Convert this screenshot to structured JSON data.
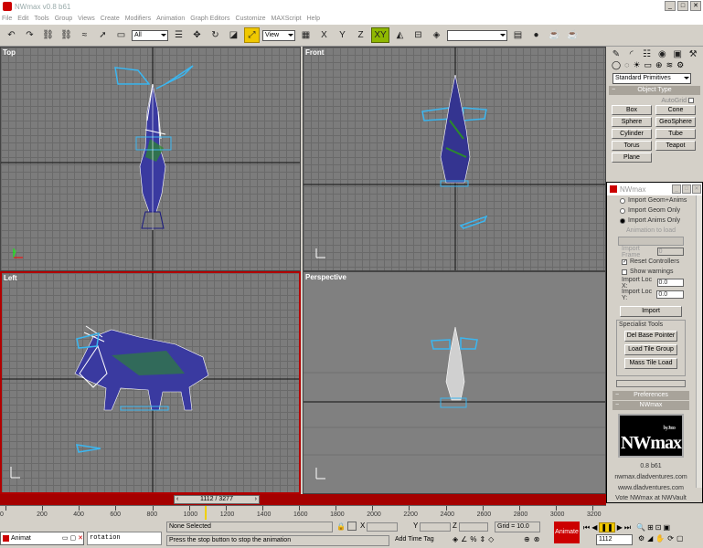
{
  "window": {
    "title": "NWmax v0.8 b61",
    "buttons": [
      "_",
      "□",
      "✕"
    ]
  },
  "menu": [
    "File",
    "Edit",
    "Tools",
    "Group",
    "Views",
    "Create",
    "Modifiers",
    "Animation",
    "Graph Editors",
    "Customize",
    "MAXScript",
    "Help"
  ],
  "toolbar": {
    "selection_filter": "All",
    "ref_coord": "View",
    "axis": "XY",
    "named_selection": ""
  },
  "viewports": {
    "top": "Top",
    "front": "Front",
    "left": "Left",
    "perspective": "Perspective"
  },
  "command_panel": {
    "category": "Standard Primitives",
    "object_type_header": "Object Type",
    "autogrid": "AutoGrid",
    "buttons": [
      "Box",
      "Cone",
      "Sphere",
      "GeoSphere",
      "Cylinder",
      "Tube",
      "Torus",
      "Teapot",
      "Plane"
    ]
  },
  "nwmax": {
    "title": "NWmax",
    "import_options": [
      "Import Geom+Anims",
      "Import Geom Only",
      "Import Anims Only"
    ],
    "animation_label": "Animation to load",
    "start_frame_label": "Import Frame",
    "start_frame_value": "0",
    "reset_controllers": "Reset Controllers",
    "show_warnings": "Show warnings",
    "import_loc_x_label": "Import Loc X:",
    "import_loc_x": "0.0",
    "import_loc_y_label": "Import Loc Y:",
    "import_loc_y": "0.0",
    "import_button": "Import",
    "specialist_tools": "Specialist Tools",
    "del_base_pointer": "Del Base Pointer",
    "load_tile_group": "Load Tile Group",
    "mass_tile_load": "Mass Tile Load",
    "preferences": "Preferences",
    "nwmax_header": "NWmax",
    "logo_by": "by Joco",
    "logo_text": "NWmax",
    "version": "0.8 b61",
    "site1": "nwmax.dladventures.com",
    "site2": "www.dladventures.com",
    "vote": "Vote NWmax at NWVault"
  },
  "timeline": {
    "frame_display": "1112 / 3277",
    "ticks": [
      "0",
      "200",
      "400",
      "600",
      "800",
      "1000",
      "1200",
      "1400",
      "1600",
      "1800",
      "2000",
      "2200",
      "2400",
      "2600",
      "2800",
      "3000",
      "3200"
    ],
    "progress": 0.339
  },
  "status": {
    "selection": "None Selected",
    "prompt": "Press the stop button to stop the animation",
    "grid": "Grid = 10.0",
    "add_time_tag": "Add Time Tag",
    "animate": "Animate",
    "frame": "1112",
    "x_label": "X",
    "y_label": "Y",
    "z_label": "Z"
  },
  "taskbar": {
    "minimized_title": "Animat",
    "listener_text": "rotation"
  }
}
